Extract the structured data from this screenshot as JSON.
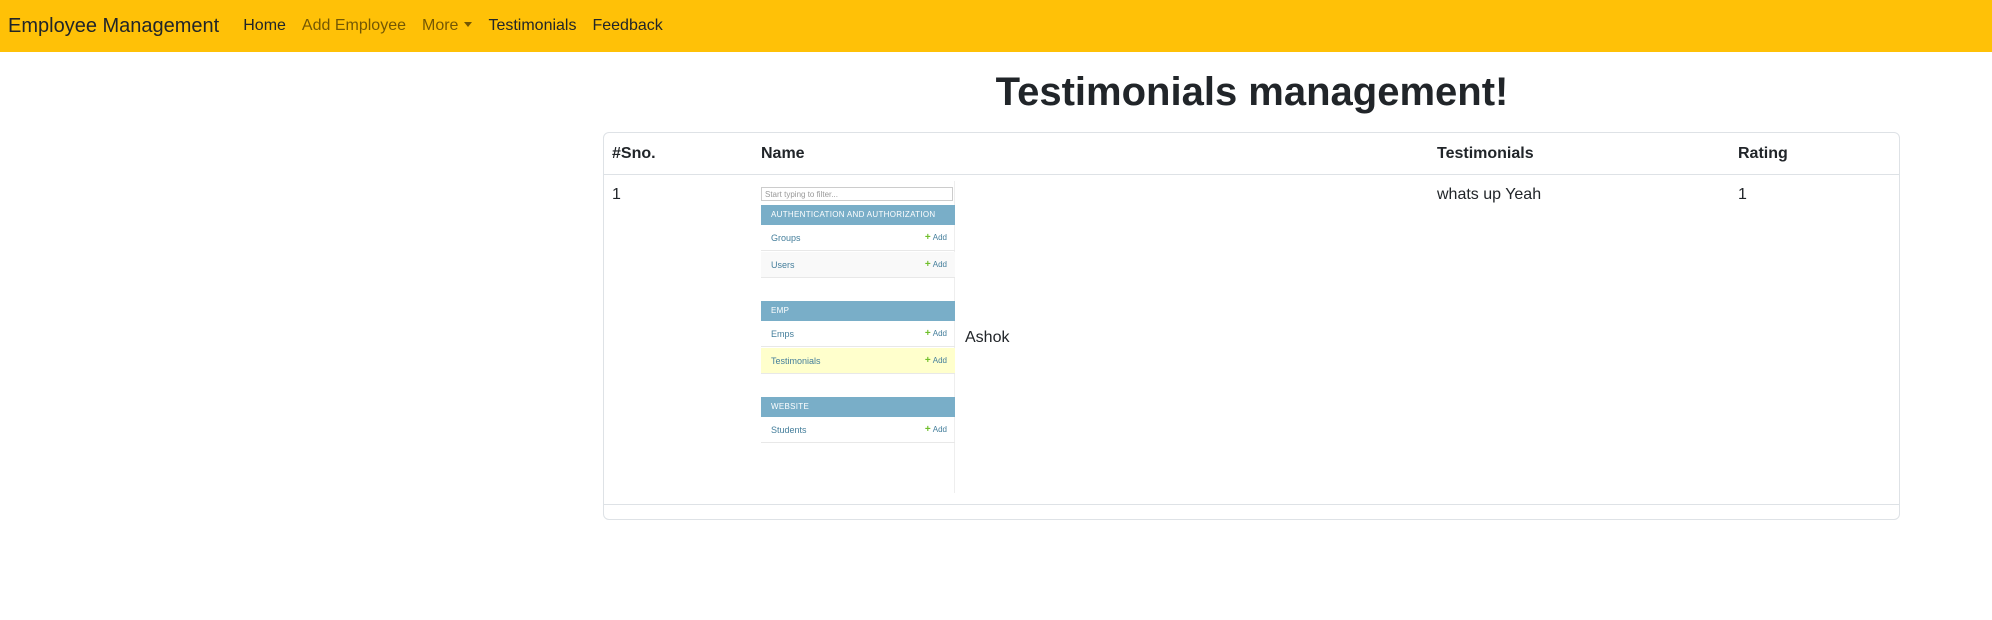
{
  "navbar": {
    "brand": "Employee Management",
    "links": [
      "Home",
      "Add Employee",
      "More",
      "Testimonials",
      "Feedback"
    ]
  },
  "page_title": "Testimonials management!",
  "table": {
    "headers": [
      "#Sno.",
      "Name",
      "Testimonials",
      "Rating"
    ],
    "rows": [
      {
        "sno": "1",
        "name": "Ashok",
        "testimonial": "whats up Yeah",
        "rating": "1"
      }
    ]
  },
  "admin_image": {
    "filter_placeholder": "Start typing to filter...",
    "add_label": "Add",
    "modules": [
      {
        "title": "AUTHENTICATION AND AUTHORIZATION",
        "items": [
          "Groups",
          "Users"
        ]
      },
      {
        "title": "EMP",
        "items": [
          "Emps",
          "Testimonials"
        ]
      },
      {
        "title": "WEBSITE",
        "items": [
          "Students"
        ]
      }
    ]
  },
  "colors": {
    "navbar_bg": "#ffc107",
    "admin_module_header": "#79aec8",
    "admin_link": "#447e9b",
    "admin_highlight": "#ffffcc",
    "add_icon": "#70bf2b"
  },
  "icons": [
    "dropdown-caret-icon",
    "plus-icon"
  ]
}
